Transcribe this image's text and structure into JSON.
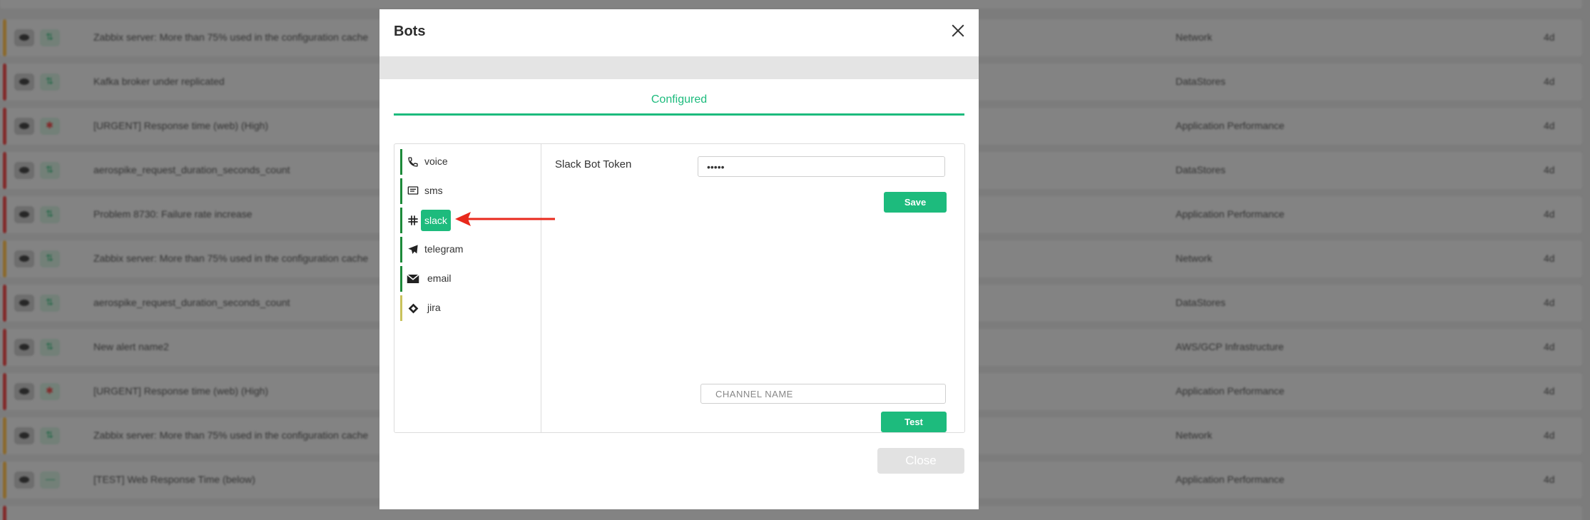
{
  "background": {
    "rows": [
      {
        "severity_color": "#f0b54b",
        "status": "ok",
        "name": "Zabbix server: More than 75% used in the configuration cache",
        "category": "Network",
        "age": "4d"
      },
      {
        "severity_color": "#e04646",
        "status": "ok",
        "name": "Kafka broker under replicated",
        "category": "DataStores",
        "age": "4d"
      },
      {
        "severity_color": "#e04646",
        "status": "crit",
        "name": "[URGENT] Response time (web) (High)",
        "category": "Application Performance",
        "age": "4d"
      },
      {
        "severity_color": "#e04646",
        "status": "ok",
        "name": "aerospike_request_duration_seconds_count",
        "category": "DataStores",
        "age": "4d"
      },
      {
        "severity_color": "#e04646",
        "status": "ok",
        "name": "Problem 8730: Failure rate increase",
        "category": "Application Performance",
        "age": "4d"
      },
      {
        "severity_color": "#f0b54b",
        "status": "ok",
        "name": "Zabbix server: More than 75% used in the configuration cache",
        "category": "Network",
        "age": "4d"
      },
      {
        "severity_color": "#e04646",
        "status": "ok",
        "name": "aerospike_request_duration_seconds_count",
        "category": "DataStores",
        "age": "4d"
      },
      {
        "severity_color": "#e04646",
        "status": "ok",
        "name": "New alert name2",
        "category": "AWS/GCP Infrastructure",
        "age": "4d"
      },
      {
        "severity_color": "#e04646",
        "status": "crit",
        "name": "[URGENT] Response time (web) (High)",
        "category": "Application Performance",
        "age": "4d"
      },
      {
        "severity_color": "#f0b54b",
        "status": "ok",
        "name": "Zabbix server: More than 75% used in the configuration cache",
        "category": "Network",
        "age": "4d"
      },
      {
        "severity_color": "#f0b54b",
        "status": "dash",
        "name": "[TEST] Web Response Time (below)",
        "category": "Application Performance",
        "age": "4d"
      }
    ]
  },
  "modal": {
    "title": "Bots",
    "tab_label": "Configured",
    "bots": [
      {
        "label": "voice",
        "icon": "phone-icon"
      },
      {
        "label": "sms",
        "icon": "message-icon"
      },
      {
        "label": "slack",
        "icon": "slack-icon",
        "active": true
      },
      {
        "label": "telegram",
        "icon": "telegram-icon"
      },
      {
        "label": "email",
        "icon": "envelope-icon"
      },
      {
        "label": "jira",
        "icon": "jira-icon"
      }
    ],
    "token_label": "Slack Bot Token",
    "token_value": "•••••",
    "save_label": "Save",
    "channel_placeholder": "CHANNEL NAME",
    "test_label": "Test",
    "close_label": "Close"
  },
  "colors": {
    "accent": "#1dbb7d",
    "annotation_arrow": "#e8291c"
  }
}
